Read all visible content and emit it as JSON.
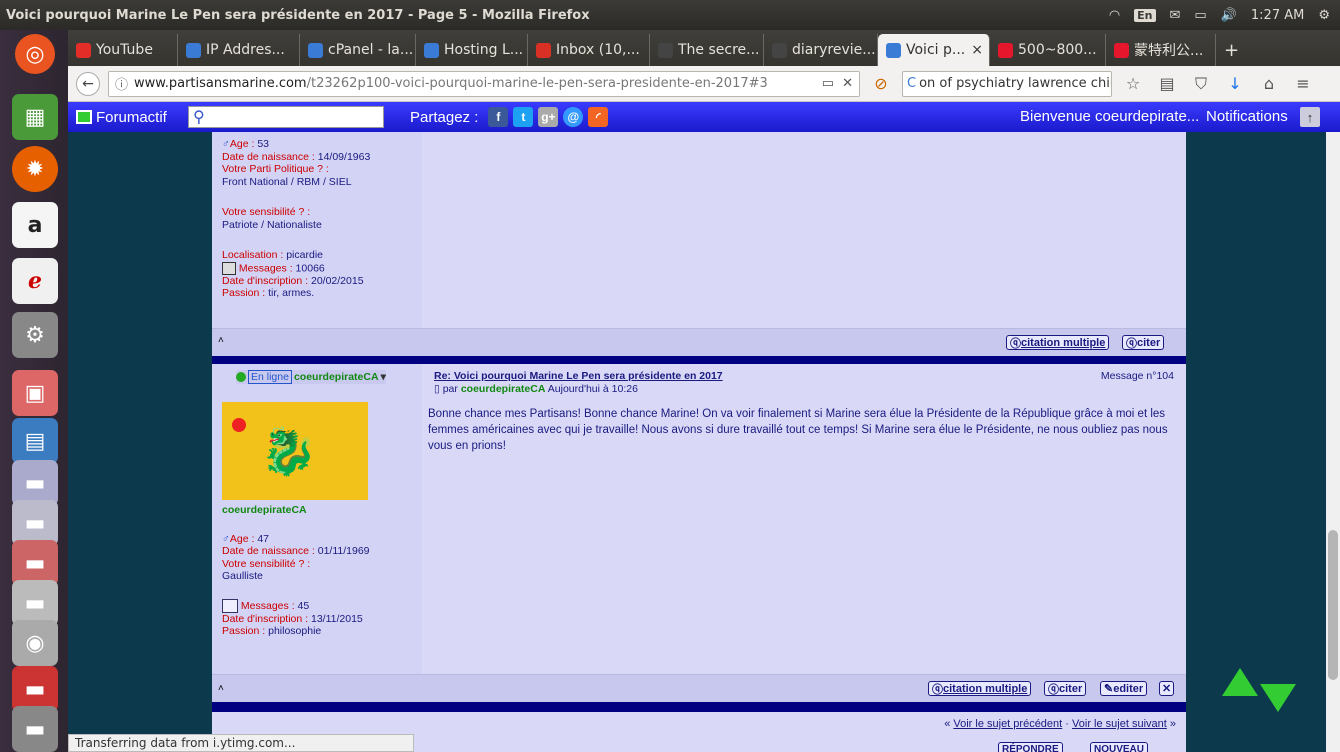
{
  "window": {
    "title": "Voici pourquoi Marine Le Pen sera présidente en 2017 - Page 5 - Mozilla Firefox"
  },
  "tray": {
    "lang": "En",
    "time": "1:27 AM"
  },
  "tabs": [
    {
      "label": "YouTube",
      "icon": "youtube-icon",
      "color": "#e52d27"
    },
    {
      "label": "IP Addres...",
      "icon": "loading-icon",
      "color": "#3a7bd5"
    },
    {
      "label": "cPanel - la...",
      "icon": "loading-icon",
      "color": "#3a7bd5"
    },
    {
      "label": "Hosting L...",
      "icon": "loading-icon",
      "color": "#3a7bd5"
    },
    {
      "label": "Inbox (10,...",
      "icon": "gmail-icon",
      "color": "#d93025"
    },
    {
      "label": "The secre...",
      "icon": "sheet-icon",
      "color": "#444"
    },
    {
      "label": "diaryrevie...",
      "icon": "sheet-icon",
      "color": "#444"
    },
    {
      "label": "Voici p...",
      "icon": "loading-icon",
      "color": "#3a7bd5",
      "active": true
    },
    {
      "label": "500~800...",
      "icon": "weibo-icon",
      "color": "#e6162d"
    },
    {
      "label": "蒙特利公...",
      "icon": "weibo-icon",
      "color": "#e6162d"
    }
  ],
  "nav": {
    "url_host": "www.partisansmarine.com",
    "url_path": "/t23262p100-voici-pourquoi-marine-le-pen-sera-presidente-en-2017#3",
    "search_value": "on of psychiatry lawrence chin"
  },
  "forum_bar": {
    "logo": "Forumactif",
    "share_label": "Partagez :",
    "welcome": "Bienvenue coeurdepirate...",
    "notifications": "Notifications"
  },
  "post1_profile": {
    "age_label": "Age",
    "age": "53",
    "birth_label": "Date de naissance",
    "birth": "14/09/1963",
    "party_label": "Votre Parti Politique ?",
    "party": "Front National / RBM / SIEL",
    "sens_label": "Votre sensibilité ?",
    "sens": "Patriote / Nationaliste",
    "loc_label": "Localisation",
    "loc": "picardie",
    "msg_label": "Messages",
    "msg": "10066",
    "insc_label": "Date d'inscription",
    "insc": "20/02/2015",
    "passion_label": "Passion",
    "passion": "tir, armes."
  },
  "post2": {
    "online": "En ligne",
    "username": "coeurdepirateCA",
    "title": "Re: Voici pourquoi Marine Le Pen sera présidente en 2017",
    "by": "par",
    "date": "Aujourd'hui à 10:26",
    "msg_no": "Message n°104",
    "body": "Bonne chance mes Partisans! Bonne chance Marine! On va voir finalement si Marine sera élue la Présidente de la République grâce à moi et les femmes américaines avec qui je travaille! Nous avons si dure travaillé tout ce temps! Si Marine sera élue le Présidente, ne nous oubliez pas nous vous en prions!",
    "age_label": "Age",
    "age": "47",
    "birth_label": "Date de naissance",
    "birth": "01/11/1969",
    "sens_label": "Votre sensibilité ?",
    "sens": "Gaulliste",
    "msg_label": "Messages",
    "msg": "45",
    "insc_label": "Date d'inscription",
    "insc": "13/11/2015",
    "passion_label": "Passion",
    "passion": "philosophie"
  },
  "buttons": {
    "multi": "citation multiple",
    "cite": "citer",
    "edit": "editer"
  },
  "pager": {
    "prev": "Voir le sujet précédent",
    "next": "Voir le sujet suivant",
    "prefix": "«",
    "suffix": "»",
    "sep": "·"
  },
  "bottom_btns": {
    "reply": "RÉPONDRE",
    "new": "NOUVEAU"
  },
  "status": "Transferring data from i.ytimg.com..."
}
